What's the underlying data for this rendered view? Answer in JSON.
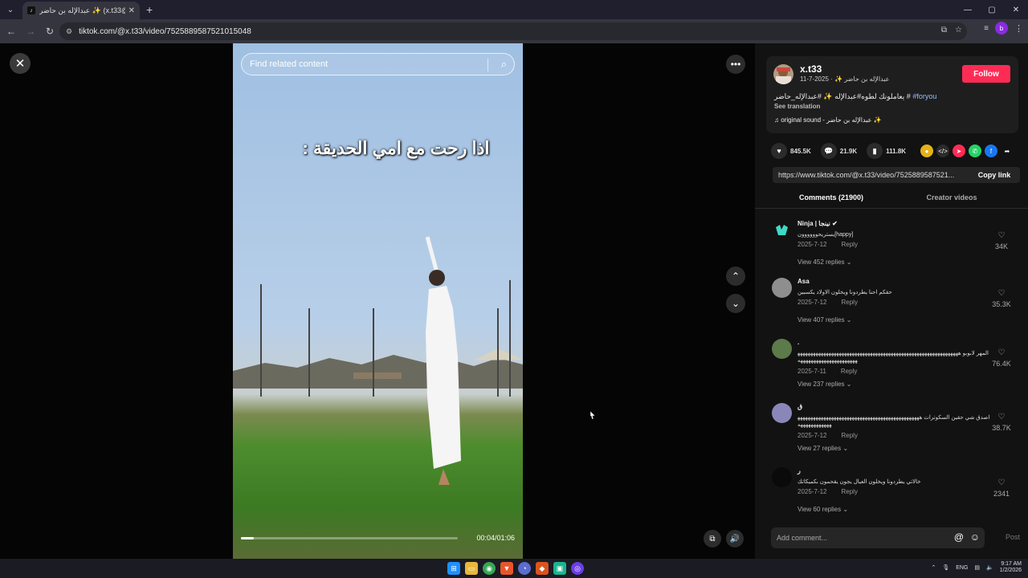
{
  "browser": {
    "tab_title": "عبدالإله بن حاضر ✨ (x.t33@) | TikTok",
    "favicon": "tiktok-icon",
    "url": "tiktok.com/@x.t33/video/7525889587521015048",
    "profile_initial": "b",
    "window_controls": [
      "—",
      "▢",
      "✕"
    ]
  },
  "video": {
    "search_placeholder": "Find related content",
    "caption": "اذا رحت مع امي الحديقة :",
    "time": "00:04/01:06",
    "progress_fraction": 0.06
  },
  "info": {
    "author_handle": "x.t33",
    "author_meta": "عبدالإله بن حاضر ✨ · 2025-7-11",
    "follow_label": "Follow",
    "description_text": "يعاملونك لطوه#عبدالإله ✨ #عبدالإله_حاضر #",
    "description_tag": "#foryou",
    "see_translation": "See translation",
    "sound": "♫  original sound - عبدالإله بن حاضر ✨"
  },
  "actions": {
    "likes": "845.5K",
    "comments": "21.9K",
    "saves": "111.8K"
  },
  "share": {
    "link": "https://www.tiktok.com/@x.t33/video/7525889587521...",
    "copy_label": "Copy link"
  },
  "tabs": {
    "comments": "Comments (21900)",
    "creator": "Creator videos"
  },
  "comments": [
    {
      "name": "Ninja | نينجا ✔",
      "text": "يستريحوووووون[happy]",
      "date": "2025-7-12",
      "reply": "Reply",
      "replies": "View 452 replies ⌄",
      "likes": "34K"
    },
    {
      "name": "Asa",
      "text": "حقكم احنا يطردونا ويخلون الاولاد يكسبين",
      "date": "2025-7-12",
      "reply": "Reply",
      "replies": "View 407 replies ⌄",
      "likes": "35.3K"
    },
    {
      "name": ".",
      "text": "المهر لابوبو هههههههههههههههههههههههههههههههههههههههههههههههههههههههههههههههههههههههههههههههههههههه",
      "date": "2025-7-11",
      "reply": "Reply",
      "replies": "View 237 replies ⌄",
      "likes": "76.4K"
    },
    {
      "name": "ق",
      "text": "اصدق شي حقين السكوترات ههههههههههههههههههههههههههههههههههههههههههههههههههههههههههههه",
      "date": "2025-7-12",
      "reply": "Reply",
      "replies": "View 27 replies ⌄",
      "likes": "38.7K"
    },
    {
      "name": "ر",
      "text": "خالاتي يطردونا ويخلون العيال يجون يقحمون بكميكاتك",
      "date": "2025-7-12",
      "reply": "Reply",
      "replies": "View 60 replies ⌄",
      "likes": "2341"
    }
  ],
  "comment_bar": {
    "placeholder": "Add comment...",
    "post": "Post"
  },
  "taskbar": {
    "lang": "ENG",
    "time": "9:17 AM",
    "date": "1/2/2026"
  },
  "colors": {
    "follow": "#fe2c55",
    "tag": "#8fc0ff"
  }
}
